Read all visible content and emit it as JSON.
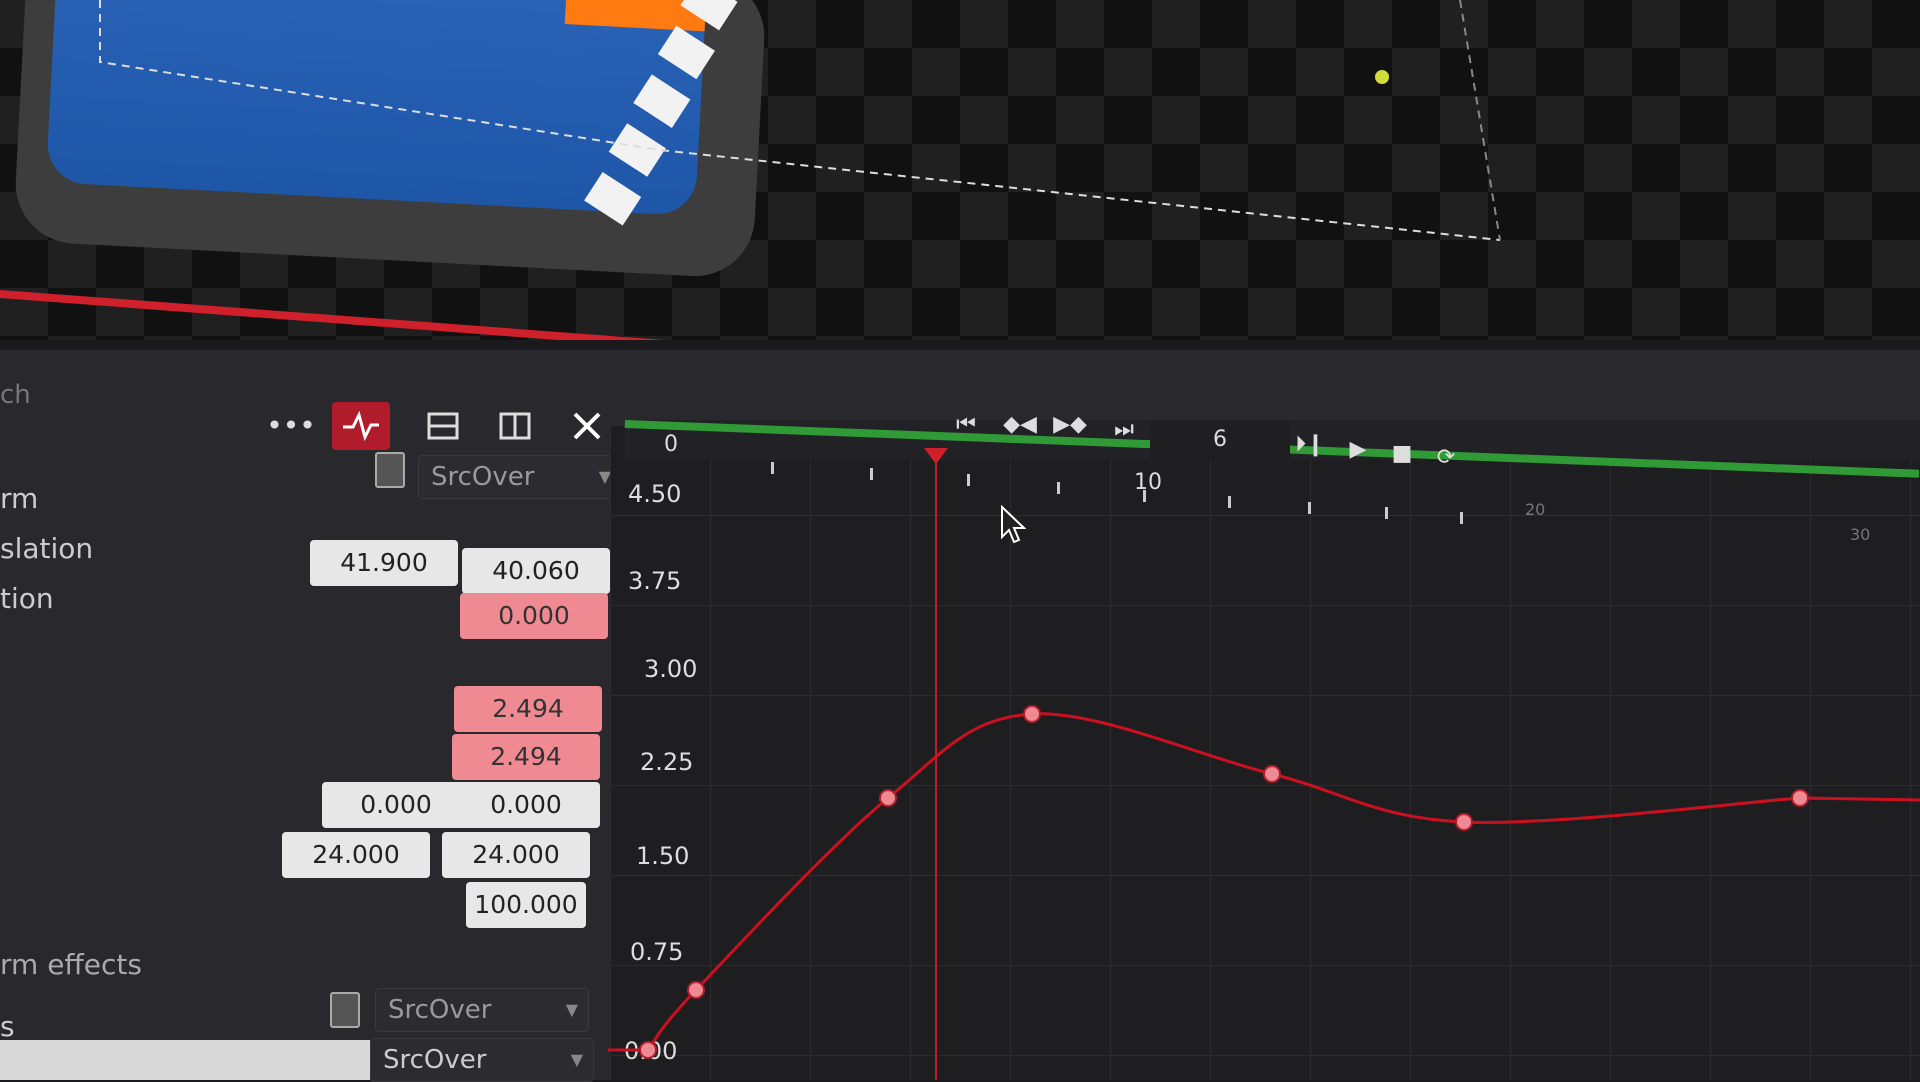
{
  "app": {
    "accent": "#b01c2c",
    "keyframe_color": "#ef8a92",
    "curve_color": "#cc1020",
    "range_color": "#2f9a36"
  },
  "search": {
    "text": "ch"
  },
  "toolbar": {
    "more_icon": "more-icon",
    "curve_icon": "curve-editor-icon",
    "stack_icon": "horizontal-split-icon",
    "columns_icon": "vertical-split-icon",
    "close_icon": "close-icon"
  },
  "layer": {
    "blend_mode": "SrcOver"
  },
  "params": {
    "transform_label": "rm",
    "translation_label": "slation",
    "translation_x": "41.900",
    "translation_y": "40.060",
    "rotation_label": "tion",
    "rotation": "0.000",
    "scale_x": "2.494",
    "scale_y": "2.494",
    "skew_x": "0.000",
    "skew_y": "0.000",
    "center_x": "24.000",
    "center_y": "24.000",
    "opacity": "100.000"
  },
  "effects": {
    "label": "rm effects",
    "blend_mode_1": "SrcOver",
    "blend_mode_2": "SrcOver",
    "row_label": "s"
  },
  "transport": {
    "current_frame": "6",
    "buttons": [
      "go-to-start-icon",
      "prev-keyframe-icon",
      "next-keyframe-icon",
      "go-to-end-icon",
      "step-forward-icon",
      "play-icon",
      "stop-icon",
      "loop-icon"
    ]
  },
  "ruler": {
    "labels": [
      "0",
      "10",
      "20",
      "30"
    ]
  },
  "chart_data": {
    "type": "line",
    "x": [
      0,
      1,
      5,
      8,
      13,
      17,
      24
    ],
    "y": [
      0,
      0.5,
      2.1,
      2.8,
      2.3,
      1.9,
      2.1
    ],
    "yticks": [
      "4.50",
      "3.75",
      "3.00",
      "2.25",
      "1.50",
      "0.75",
      "0.00"
    ],
    "ylim": [
      0,
      4.5
    ],
    "playhead_frame": 6
  }
}
